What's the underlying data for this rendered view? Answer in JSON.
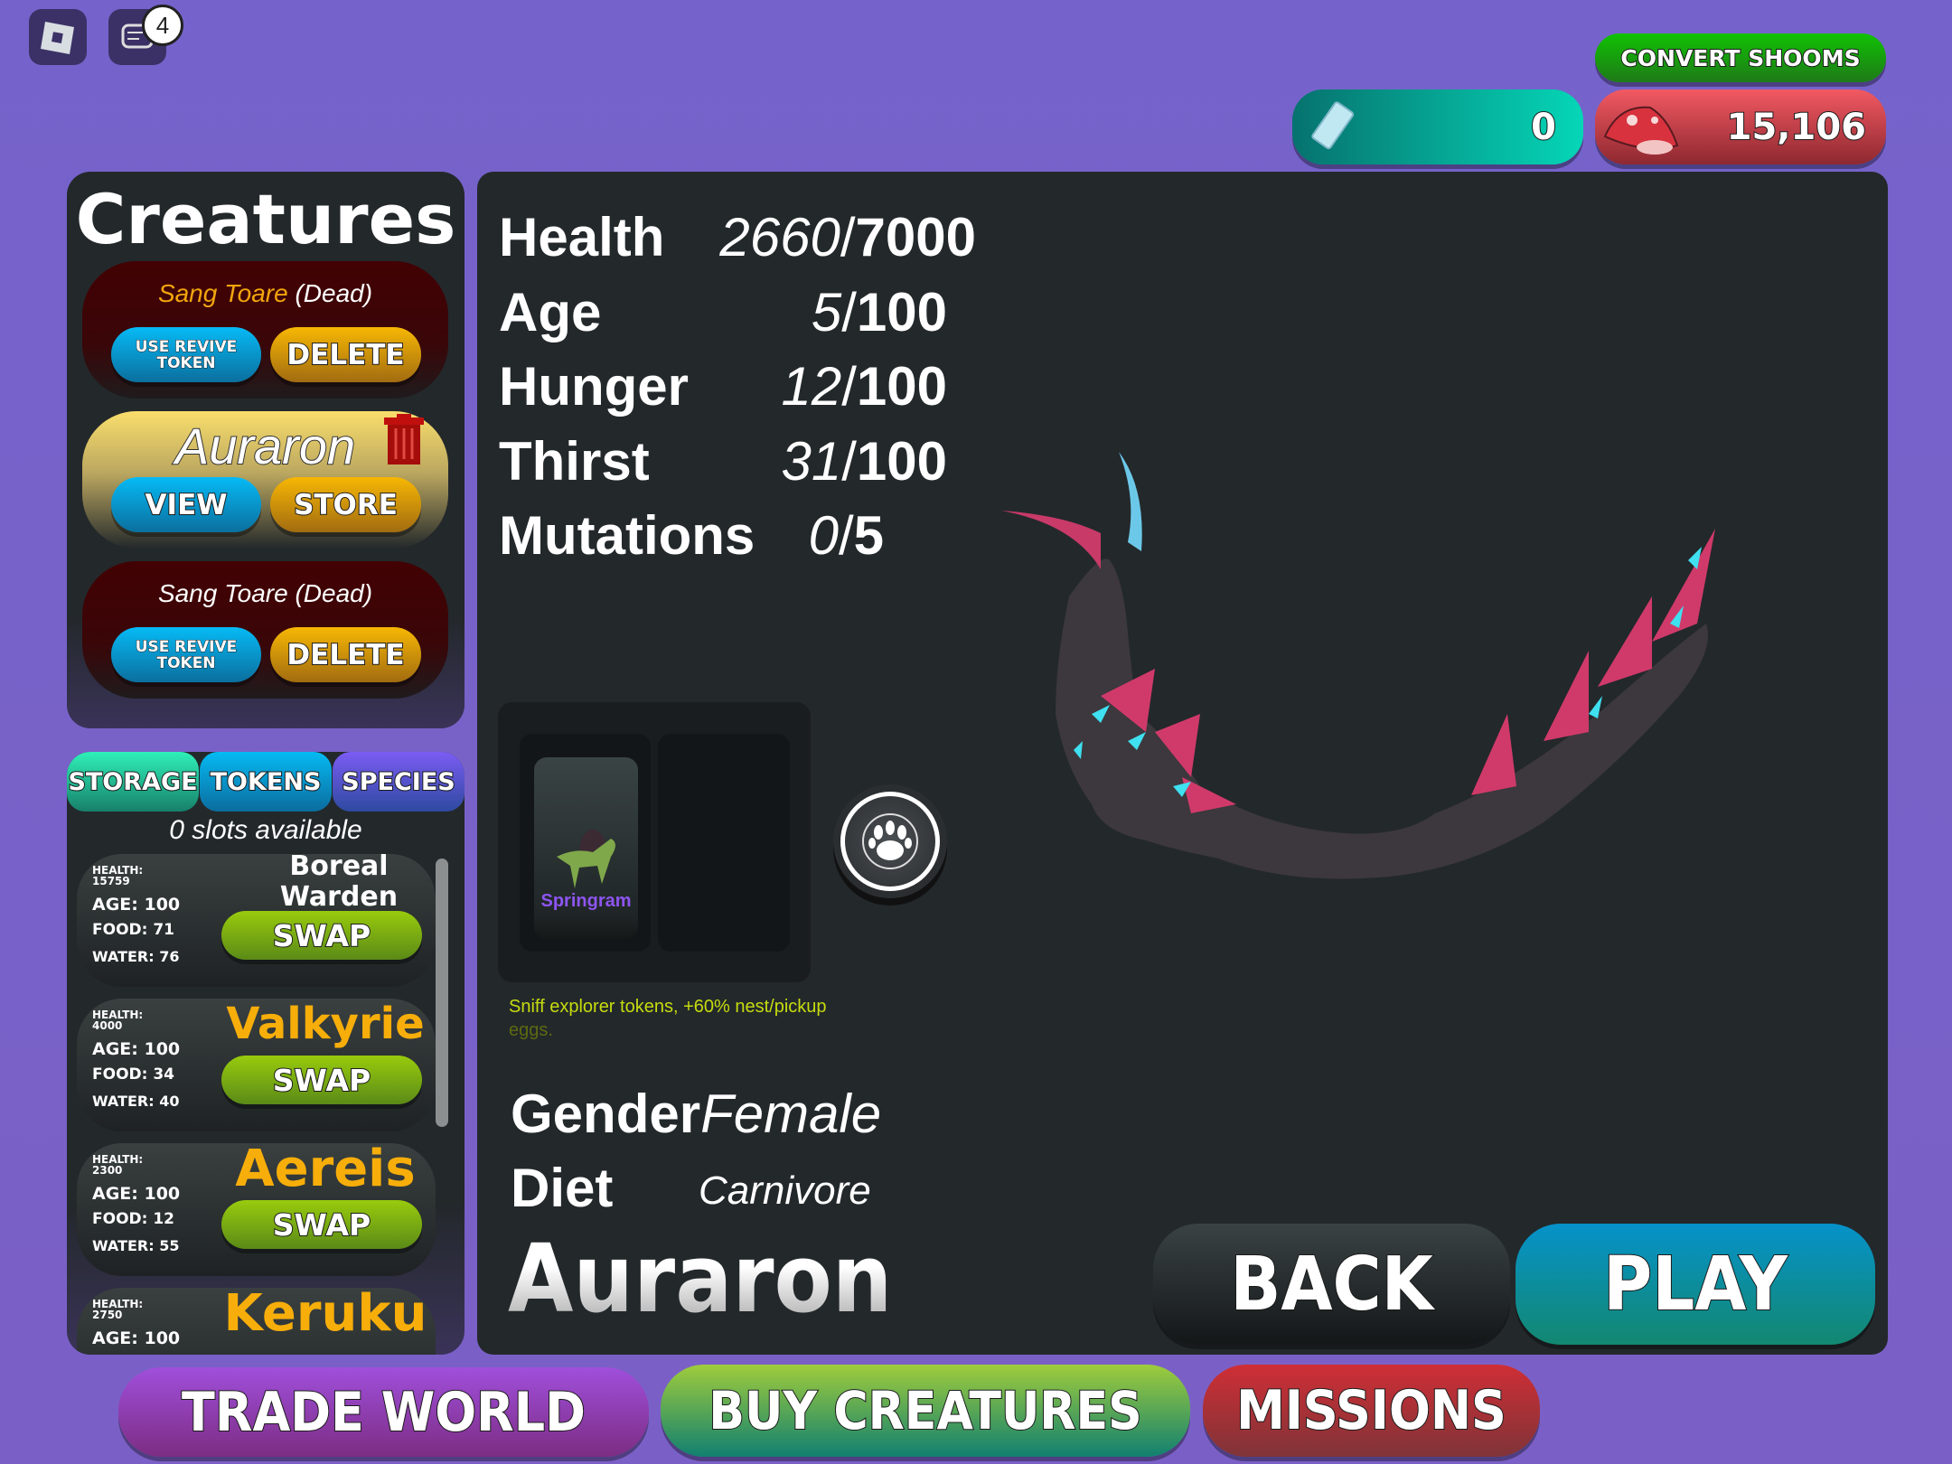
{
  "topbar": {
    "roblox_icon": "roblox-logo-icon",
    "chat_icon": "chat-icon",
    "chat_badge": "4"
  },
  "currency": {
    "convert_label": "CONVERT SHOOMS",
    "tokens_value": "0",
    "tokens_icon": "ticket-icon",
    "shrooms_value": "15,106",
    "shrooms_icon": "mushroom-icon"
  },
  "creatures_panel": {
    "title": "Creatures",
    "cards": [
      {
        "name": "Sang Toare",
        "status": "(Dead)",
        "left_button": "USE REVIVE TOKEN",
        "right_button": "DELETE"
      },
      {
        "name": "Auraron",
        "left_button": "VIEW",
        "right_button": "STORE",
        "delete_icon": "trash-icon"
      },
      {
        "name": "Sang Toare",
        "status": "(Dead)",
        "left_button": "USE REVIVE TOKEN",
        "right_button": "DELETE"
      }
    ]
  },
  "storage_panel": {
    "tabs": [
      {
        "label": "STORAGE"
      },
      {
        "label": "TOKENS"
      },
      {
        "label": "SPECIES"
      }
    ],
    "slots_text": "0 slots available",
    "items": [
      {
        "name": "Boreal Warden",
        "health": "HEALTH: 15759",
        "age": "AGE: 100",
        "food": "FOOD: 71",
        "water": "WATER: 76",
        "button": "SWAP"
      },
      {
        "name": "Valkyrie",
        "health": "HEALTH: 4000",
        "age": "AGE: 100",
        "food": "FOOD: 34",
        "water": "WATER: 40",
        "button": "SWAP"
      },
      {
        "name": "Aereis",
        "health": "HEALTH: 2300",
        "age": "AGE: 100",
        "food": "FOOD: 12",
        "water": "WATER: 55",
        "button": "SWAP"
      },
      {
        "name": "Keruku",
        "health": "HEALTH: 2750",
        "age": "AGE: 100"
      }
    ]
  },
  "details": {
    "stats": [
      {
        "label": "Health",
        "current": "2660",
        "max": "7000"
      },
      {
        "label": "Age",
        "current": "5",
        "max": "100"
      },
      {
        "label": "Hunger",
        "current": "12",
        "max": "100"
      },
      {
        "label": "Thirst",
        "current": "31",
        "max": "100"
      },
      {
        "label": "Mutations",
        "current": "0",
        "max": "5"
      }
    ],
    "token_slot": {
      "name": "Springram",
      "description": "Sniff explorer tokens, +60% nest/pickup",
      "description_cont": "eggs."
    },
    "paw_icon": "paw-icon",
    "gender_label": "Gender",
    "gender_value": "Female",
    "diet_label": "Diet",
    "diet_value": "Carnivore",
    "species_name": "Auraron",
    "back_label": "BACK",
    "play_label": "PLAY"
  },
  "bottom_nav": [
    {
      "label": "TRADE WORLD"
    },
    {
      "label": "BUY CREATURES"
    },
    {
      "label": "MISSIONS"
    }
  ]
}
